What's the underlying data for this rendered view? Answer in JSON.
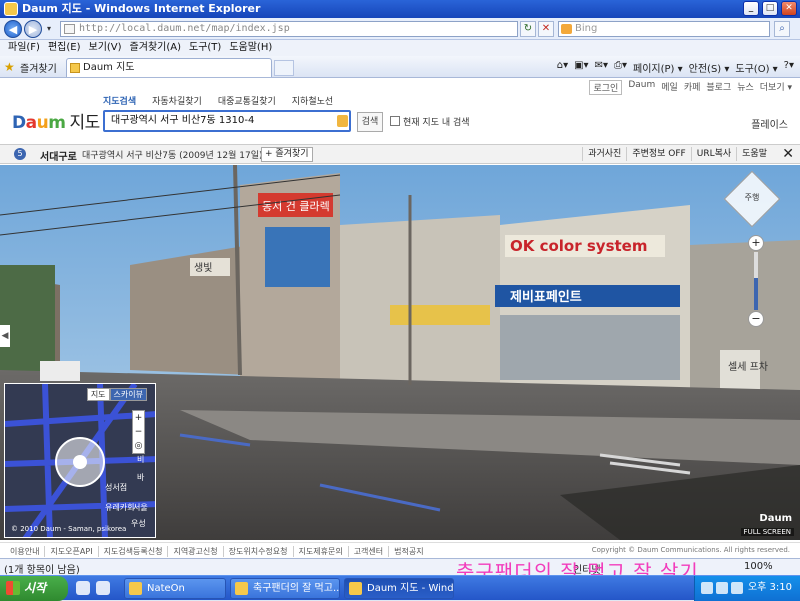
{
  "window": {
    "title": "Daum 지도 - Windows Internet Explorer"
  },
  "address": {
    "url": "http://local.daum.net/map/index.jsp",
    "search_placeholder": "Bing"
  },
  "menu": [
    "파일(F)",
    "편집(E)",
    "보기(V)",
    "즐겨찾기(A)",
    "도구(T)",
    "도움말(H)"
  ],
  "favorites": {
    "label": "즐겨찾기",
    "tab_title": "Daum 지도"
  },
  "commands": [
    "페이지(P) ▾",
    "안전(S) ▾",
    "도구(O) ▾"
  ],
  "daum": {
    "logo": {
      "d": "D",
      "a": "a",
      "u": "u",
      "m": "m",
      "jido": "지도"
    },
    "top_links": [
      "로그인",
      "Daum",
      "메일",
      "카페",
      "블로그",
      "뉴스",
      "더보기 ▾"
    ],
    "search_tabs": [
      "지도검색",
      "자동차길찾기",
      "대중교통길찾기",
      "지하철노선"
    ],
    "search_value": "대구광역시 서구 비산7동 1310-4",
    "search_button": "검색",
    "within_map_label": "현재 지도 내 검색",
    "places_label": "플레이스"
  },
  "location": {
    "badge": "5",
    "name": "서대구로",
    "address": "대구광역시 서구 비산7동 (2009년 12월 17일)",
    "fav_button": "+ 즐겨찾기",
    "buttons": [
      "과거사진",
      "주변정보 OFF",
      "URL복사",
      "도움말"
    ],
    "close": "✕"
  },
  "panorama": {
    "signs": [
      "동서 건 클라렉",
      "OK color system",
      "제비표페인트",
      "생빛",
      "셀세 프차"
    ],
    "minimap_tabs": [
      "지도",
      "스카이뷰"
    ],
    "minimap_zoom": [
      "+",
      "−",
      "◎"
    ],
    "minimap_copyright": "© 2010 Daum - Saman, psikorea",
    "minimap_labels": [
      "비",
      "바",
      "성서점",
      "유레카회",
      "서울",
      "우성"
    ],
    "nav_label": "주행",
    "zoom": {
      "plus": "+",
      "minus": "−",
      "level": 0.55
    },
    "watermark": "Daum",
    "fullscreen": "FULL SCREEN",
    "left_arrow": "◀"
  },
  "footer": {
    "links": [
      "이용안내",
      "지도오픈API",
      "지도검색등록신청",
      "지역광고신청",
      "장도위치수정요청",
      "지도제휴문의",
      "고객센터",
      "법적공지"
    ],
    "copyright": "Copyright © Daum Communications. All rights reserved."
  },
  "status": {
    "left": "(1개 항목이 남음)",
    "net": "인터넷",
    "zoom": "100%"
  },
  "overlay_text": "축구팬더의 잘 먹고 잘 살기",
  "taskbar": {
    "start": "시작",
    "items": [
      "NateOn",
      "축구팬더의 잘 먹고...",
      "Daum 지도 - Wind..."
    ],
    "clock": "오후 3:10"
  }
}
